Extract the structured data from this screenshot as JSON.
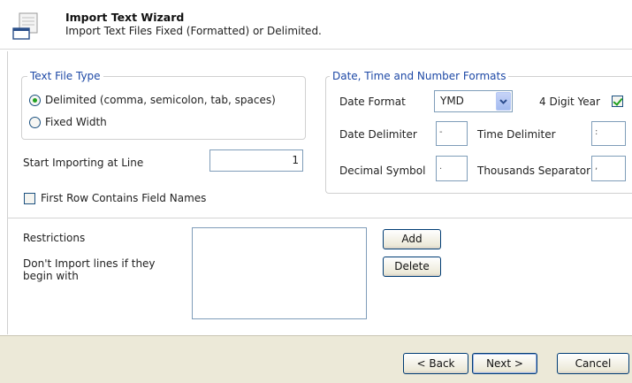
{
  "header": {
    "title": "Import Text Wizard",
    "subtitle": "Import Text Files Fixed (Formatted) or Delimited."
  },
  "file_type": {
    "legend": "Text File Type",
    "options": [
      {
        "label": "Delimited (comma, semicolon, tab, spaces)",
        "selected": true
      },
      {
        "label": "Fixed Width",
        "selected": false
      }
    ]
  },
  "start_line": {
    "label": "Start Importing at Line",
    "value": "1"
  },
  "first_row": {
    "label": "First Row Contains Field Names",
    "checked": false
  },
  "formats": {
    "legend": "Date, Time and Number Formats",
    "date_format_label": "Date Format",
    "date_format_value": "YMD",
    "four_digit_year_label": "4 Digit Year",
    "four_digit_year_checked": true,
    "date_delimiter_label": "Date Delimiter",
    "date_delimiter_value": "-",
    "time_delimiter_label": "Time Delimiter",
    "time_delimiter_value": ":",
    "decimal_label": "Decimal Symbol",
    "decimal_value": ".",
    "thousands_label": "Thousands Separator",
    "thousands_value": ","
  },
  "restrictions": {
    "label": "Restrictions",
    "description": "Don't Import lines if they begin with",
    "add_label": "Add",
    "delete_label": "Delete"
  },
  "footer": {
    "back_label": "< Back",
    "next_label": "Next >",
    "cancel_label": "Cancel"
  }
}
